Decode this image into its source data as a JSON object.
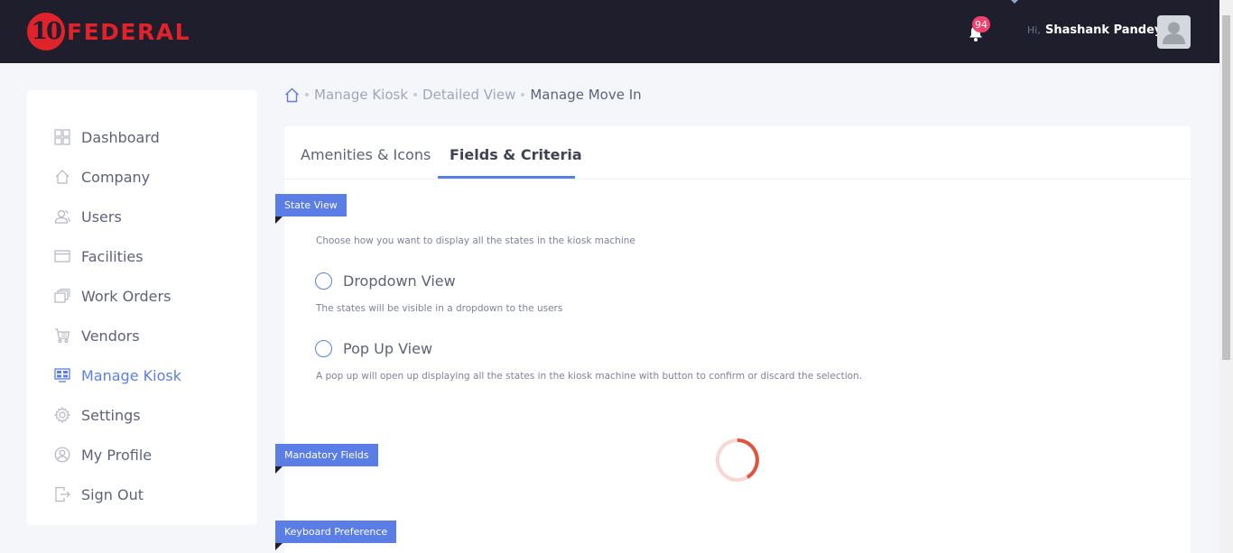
{
  "header": {
    "logo_number": "10",
    "logo_text": "FEDERAL",
    "notification_count": "94",
    "greeting": "Hi,",
    "user_name": "Shashank Pandey"
  },
  "sidebar": {
    "items": [
      {
        "label": "Dashboard",
        "icon": "dashboard-icon"
      },
      {
        "label": "Company",
        "icon": "home-icon"
      },
      {
        "label": "Users",
        "icon": "users-icon"
      },
      {
        "label": "Facilities",
        "icon": "facilities-icon"
      },
      {
        "label": "Work Orders",
        "icon": "work-orders-icon"
      },
      {
        "label": "Vendors",
        "icon": "cart-icon"
      },
      {
        "label": "Manage Kiosk",
        "icon": "kiosk-icon",
        "active": true
      },
      {
        "label": "Settings",
        "icon": "gear-icon"
      },
      {
        "label": "My Profile",
        "icon": "profile-icon"
      },
      {
        "label": "Sign Out",
        "icon": "sign-out-icon"
      }
    ]
  },
  "breadcrumb": {
    "items": [
      "Manage Kiosk",
      "Detailed View"
    ],
    "current": "Manage Move In"
  },
  "tabs": [
    {
      "label": "Amenities & Icons",
      "active": false
    },
    {
      "label": "Fields & Criteria",
      "active": true
    }
  ],
  "sections": {
    "state_view": {
      "title": "State View",
      "description": "Choose how you want to display all the states in the kiosk machine",
      "options": [
        {
          "label": "Dropdown View",
          "description": "The states will be visible in a dropdown to the users",
          "selected": false
        },
        {
          "label": "Pop Up View",
          "description": "A pop up will open up displaying all the states in the kiosk machine with button to confirm or discard the selection.",
          "selected": false
        }
      ]
    },
    "mandatory_fields": {
      "title": "Mandatory Fields"
    },
    "keyboard_preference": {
      "title": "Keyboard Preference"
    }
  },
  "colors": {
    "accent": "#5b7de6",
    "header_bg": "#1e1e2d",
    "brand_red": "#e0222a",
    "badge": "#f1416c"
  }
}
